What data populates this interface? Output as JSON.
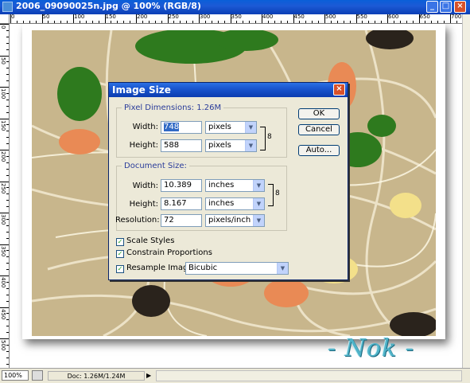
{
  "window": {
    "title": "2006_09090025n.jpg @ 100% (RGB/8)",
    "buttons": {
      "minimize": "_",
      "maximize": "□",
      "close": "×"
    }
  },
  "ruler": {
    "top_numbers": [
      "0",
      "50",
      "100",
      "150",
      "200",
      "250",
      "300",
      "350",
      "400",
      "450",
      "500",
      "550",
      "600",
      "650",
      "700"
    ],
    "left_numbers": [
      "0",
      "50",
      "100",
      "150",
      "200",
      "250",
      "300",
      "350",
      "400",
      "450",
      "500",
      "550"
    ]
  },
  "signature": "- Nok -",
  "status": {
    "zoom": "100%",
    "doc": "Doc: 1.26M/1.24M",
    "arrow": "▶"
  },
  "dialog": {
    "title": "Image Size",
    "close": "×",
    "pixel_dimensions": {
      "legend": "Pixel Dimensions:  1.26M",
      "width_label": "Width:",
      "width_value": "748",
      "width_unit": "pixels",
      "height_label": "Height:",
      "height_value": "588",
      "height_unit": "pixels"
    },
    "document_size": {
      "legend": "Document Size:",
      "width_label": "Width:",
      "width_value": "10.389",
      "width_unit": "inches",
      "height_label": "Height:",
      "height_value": "8.167",
      "height_unit": "inches",
      "resolution_label": "Resolution:",
      "resolution_value": "72",
      "resolution_unit": "pixels/inch"
    },
    "checks": {
      "scale_styles": "Scale Styles",
      "constrain": "Constrain Proportions",
      "resample": "Resample Image:",
      "resample_method": "Bicubic"
    },
    "buttons": {
      "ok": "OK",
      "cancel": "Cancel",
      "auto": "Auto..."
    }
  }
}
